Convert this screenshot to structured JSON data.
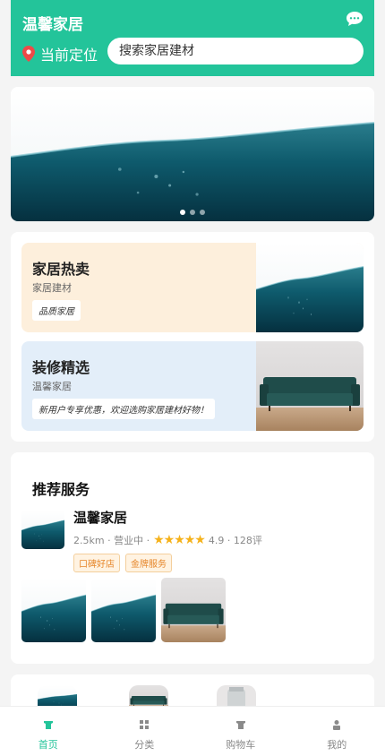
{
  "header": {
    "title": "温馨家居",
    "location_label": "当前定位",
    "search_placeholder": "搜索家居建材",
    "accent_color": "#23c49a"
  },
  "banner": {
    "dots": 3,
    "active_dot": 0
  },
  "promos": [
    {
      "title": "家居热卖",
      "subtitle": "家居建材",
      "tag": "品质家居",
      "image": "water-wave-image",
      "bg": "#fdefdc"
    },
    {
      "title": "装修精选",
      "subtitle": "温馨家居",
      "tag": "新用户专享优惠，欢迎选购家居建材好物！",
      "image": "green-sofa-image",
      "bg": "#e3eef9"
    }
  ],
  "services": {
    "section_title": "推荐服务",
    "store": {
      "name": "温馨家居",
      "distance": "2.5km",
      "status": "营业中",
      "stars": "★★★★★",
      "rating": "4.9",
      "reviews": "128评",
      "tags": [
        "口碑好店",
        "金牌服务"
      ]
    }
  },
  "tabs": [
    {
      "label": "首页",
      "icon": "home-icon",
      "active": true
    },
    {
      "label": "分类",
      "icon": "category-icon",
      "active": false
    },
    {
      "label": "购物车",
      "icon": "cart-icon",
      "active": false
    },
    {
      "label": "我的",
      "icon": "profile-icon",
      "active": false
    }
  ]
}
